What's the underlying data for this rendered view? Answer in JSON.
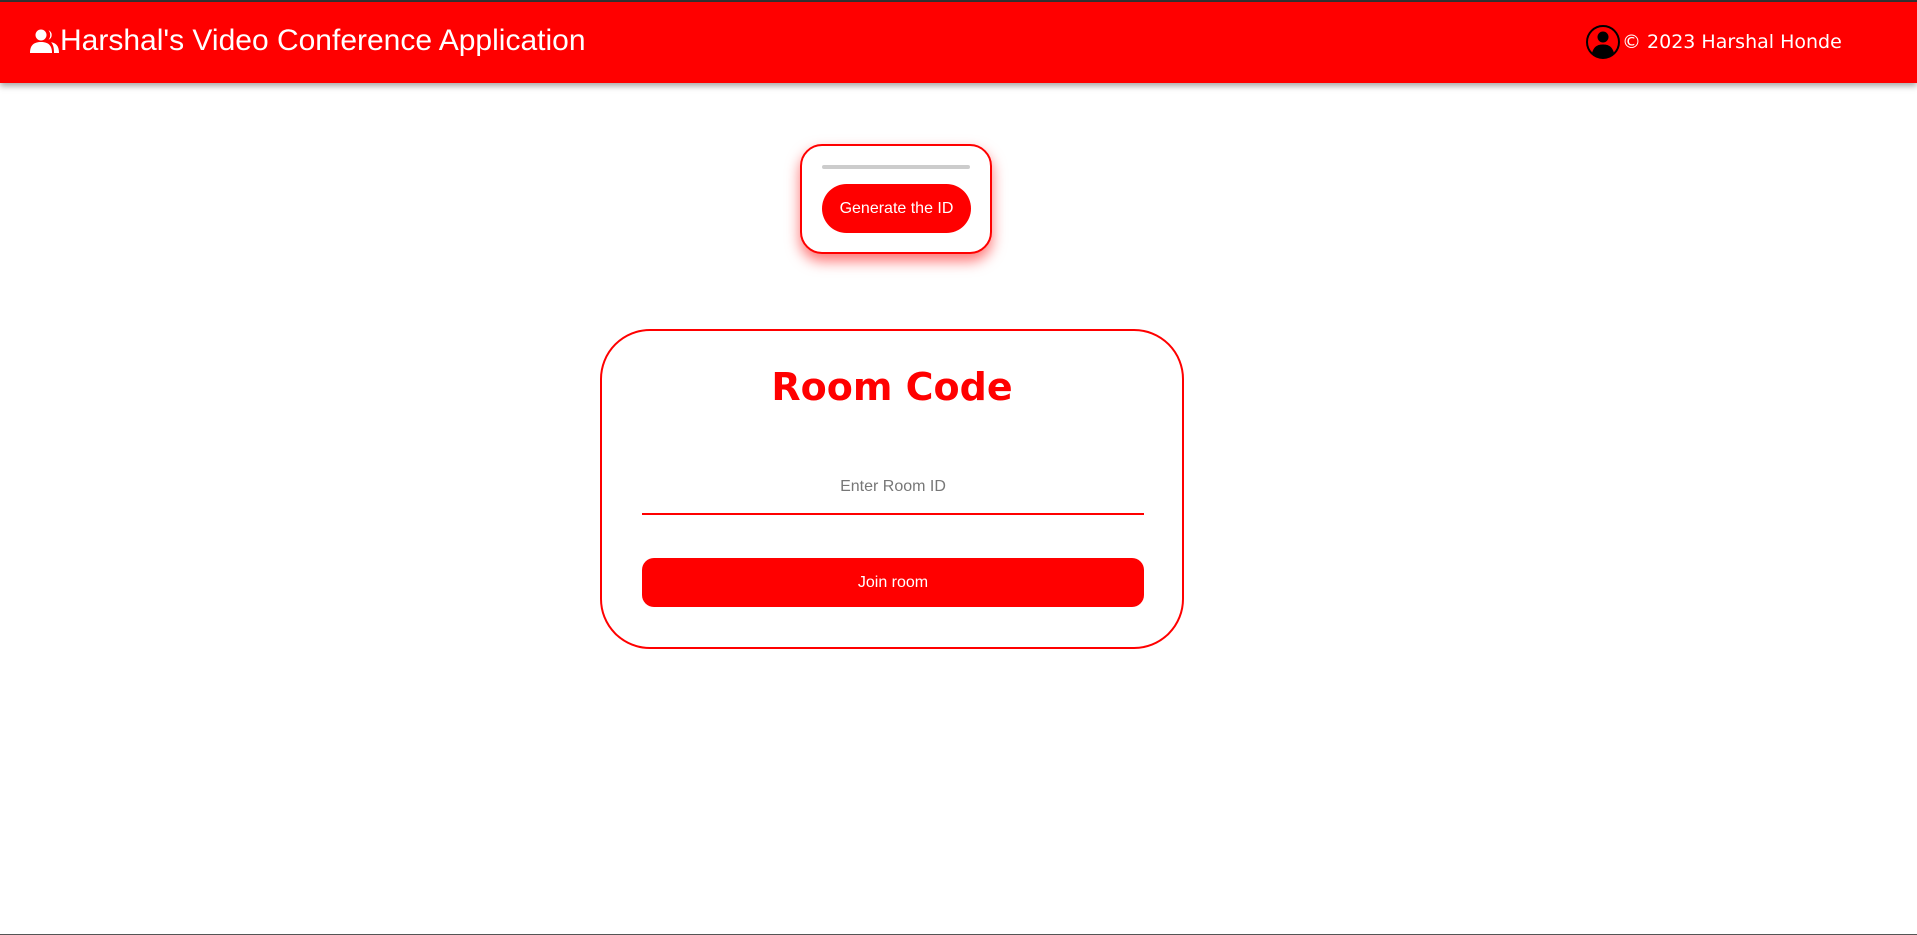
{
  "header": {
    "title": "Harshal's Video Conference Application",
    "title_icon": "users-icon",
    "copyright": "© 2023 Harshal Honde",
    "copyright_icon": "user-circle-icon"
  },
  "generator": {
    "output_value": "",
    "button_label": "Generate the ID"
  },
  "room": {
    "title": "Room Code",
    "input_value": "",
    "input_placeholder": "Enter Room ID",
    "join_label": "Join room"
  },
  "colors": {
    "accent": "#ff0000",
    "background": "#ffffff",
    "text_on_accent": "#ffffff"
  }
}
